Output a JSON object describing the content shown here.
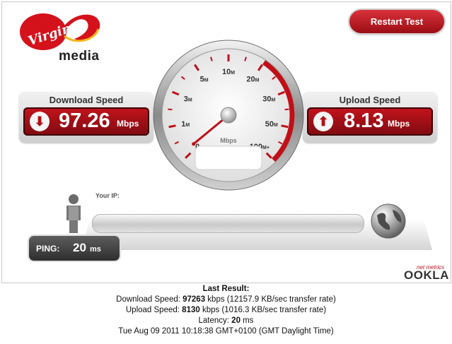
{
  "logo": {
    "brand": "Virgin",
    "sub": "media"
  },
  "restart_label": "Restart Test",
  "download": {
    "title": "Download Speed",
    "value": "97.26",
    "unit": "Mbps",
    "icon": "arrow-down-icon"
  },
  "upload": {
    "title": "Upload Speed",
    "value": "8.13",
    "unit": "Mbps",
    "icon": "arrow-up-icon"
  },
  "gauge": {
    "unit": "Mbps",
    "scale": [
      {
        "label": "0",
        "sup": ""
      },
      {
        "label": "1",
        "sup": "M"
      },
      {
        "label": "3",
        "sup": "M"
      },
      {
        "label": "5",
        "sup": "M"
      },
      {
        "label": "10",
        "sup": "M"
      },
      {
        "label": "20",
        "sup": "M"
      },
      {
        "label": "30",
        "sup": "M"
      },
      {
        "label": "50",
        "sup": "M"
      },
      {
        "label": "100",
        "sup": "M+"
      }
    ],
    "needle_scale_fraction": 0.02
  },
  "your_ip_label": "Your IP:",
  "ping": {
    "label": "PING:",
    "value": "20",
    "unit": "ms"
  },
  "ookla": {
    "netmetrics": "net metrics",
    "brand": "OOKLA"
  },
  "colors": {
    "accent": "#b3111a",
    "dark": "#333333"
  },
  "results": {
    "title": "Last Result:",
    "download_prefix": "Download Speed: ",
    "download_value": "97263",
    "download_suffix": " kbps (12157.9 KB/sec transfer rate)",
    "upload_prefix": "Upload Speed: ",
    "upload_value": "8130",
    "upload_suffix": " kbps (1016.3 KB/sec transfer rate)",
    "latency_prefix": "Latency: ",
    "latency_value": "20",
    "latency_suffix": " ms",
    "timestamp": "Tue Aug 09 2011 10:18:38 GMT+0100 (GMT Daylight Time)"
  }
}
